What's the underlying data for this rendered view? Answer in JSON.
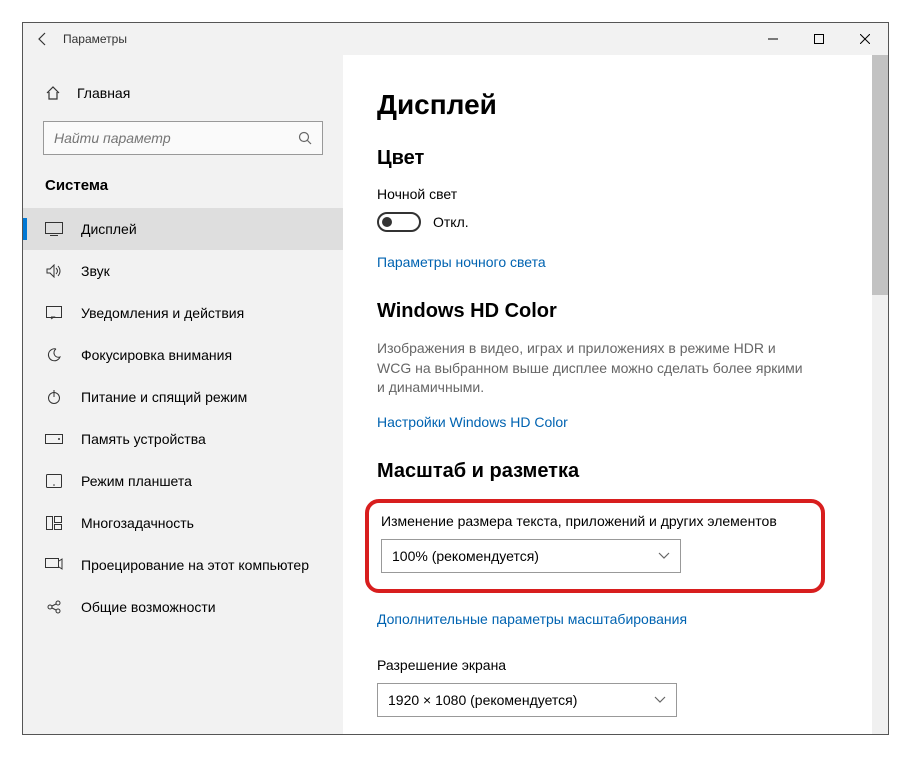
{
  "window": {
    "title": "Параметры"
  },
  "sidebar": {
    "home": "Главная",
    "search_placeholder": "Найти параметр",
    "section": "Система",
    "items": [
      {
        "label": "Дисплей"
      },
      {
        "label": "Звук"
      },
      {
        "label": "Уведомления и действия"
      },
      {
        "label": "Фокусировка внимания"
      },
      {
        "label": "Питание и спящий режим"
      },
      {
        "label": "Память устройства"
      },
      {
        "label": "Режим планшета"
      },
      {
        "label": "Многозадачность"
      },
      {
        "label": "Проецирование на этот компьютер"
      },
      {
        "label": "Общие возможности"
      }
    ]
  },
  "content": {
    "title": "Дисплей",
    "color": {
      "heading": "Цвет",
      "night_light_label": "Ночной свет",
      "toggle_state": "Откл.",
      "night_light_link": "Параметры ночного света"
    },
    "hd": {
      "heading": "Windows HD Color",
      "desc": "Изображения в видео, играх и приложениях в режиме HDR и WCG на выбранном выше дисплее можно сделать более яркими и динамичными.",
      "link": "Настройки Windows HD Color"
    },
    "scale": {
      "heading": "Масштаб и разметка",
      "text_size_label": "Изменение размера текста, приложений и других элементов",
      "text_size_value": "100% (рекомендуется)",
      "advanced_link": "Дополнительные параметры масштабирования",
      "resolution_label": "Разрешение экрана",
      "resolution_value": "1920 × 1080 (рекомендуется)"
    }
  }
}
